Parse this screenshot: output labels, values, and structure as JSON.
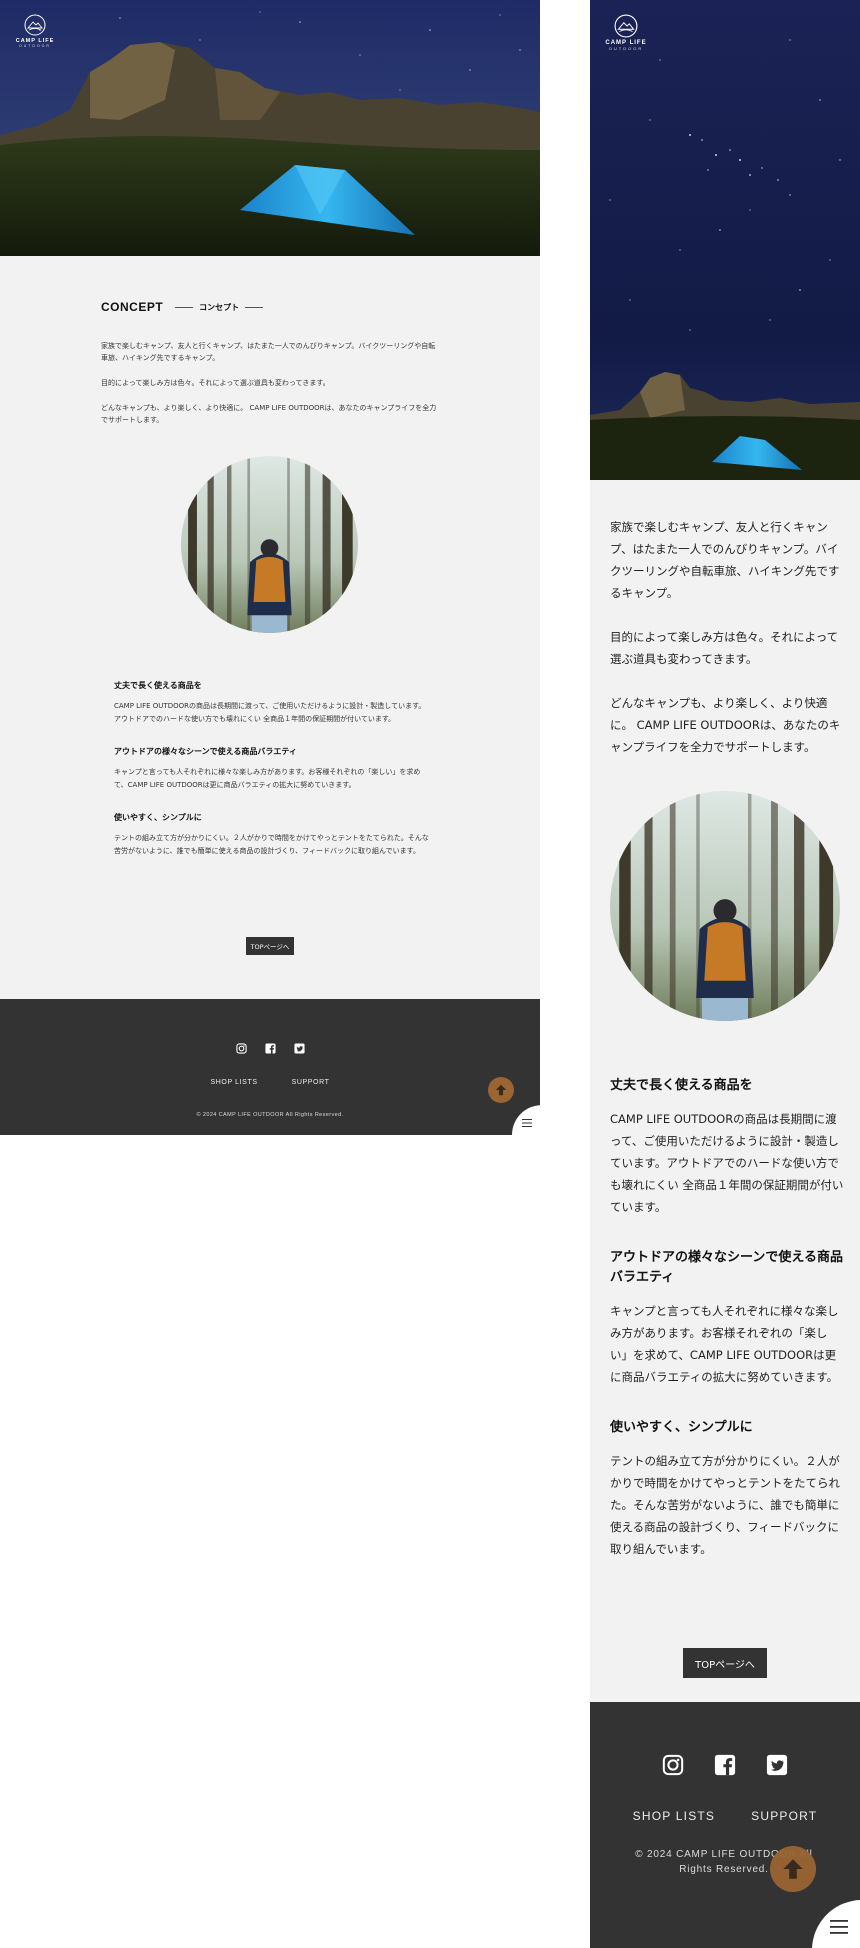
{
  "brand": {
    "name": "CAMP LIFE",
    "sub": "OUTDOOR"
  },
  "concept": {
    "title": "CONCEPT",
    "subtitle": "コンセプト"
  },
  "desktop_paragraphs": [
    "家族で楽しむキャンプ、友人と行くキャンプ、はたまた一人でのんびりキャンプ。バイクツーリングや自転車旅、ハイキング先でするキャンプ。",
    "目的によって楽しみ方は色々。それによって選ぶ道具も変わってきます。",
    "どんなキャンプも、より楽しく、より快適に。 CAMP LIFE OUTDOORは、あなたのキャンプライフを全力でサポートします。"
  ],
  "mobile_paragraphs": [
    "家族で楽しむキャンプ、友人と行くキャンプ、はたまた一人でのんびりキャンプ。バイクツーリングや自転車旅、ハイキング先でするキャンプ。",
    "目的によって楽しみ方は色々。それによって選ぶ道具も変わってきます。",
    "どんなキャンプも、より楽しく、より快適に。 CAMP LIFE OUTDOORは、あなたのキャンプライフを全力でサポートします。"
  ],
  "features": [
    {
      "title": "丈夫で長く使える商品を",
      "body": "CAMP LIFE OUTDOORの商品は長期間に渡って、ご使用いただけるように設計・製造しています。アウトドアでのハードな使い方でも壊れにくい 全商品１年間の保証期間が付いています。"
    },
    {
      "title": "アウトドアの様々なシーンで使える商品バラエティ",
      "body": "キャンプと言っても人それぞれに様々な楽しみ方があります。お客様それぞれの「楽しい」を求めて、CAMP LIFE OUTDOORは更に商品バラエティの拡大に努めていきます。"
    },
    {
      "title": "使いやすく、シンプルに",
      "body": "テントの組み立て方が分かりにくい。２人がかりで時間をかけてやっとテントをたてられた。そんな苦労がないように、誰でも簡単に使える商品の設計づくり、フィードバックに取り組んでいます。"
    }
  ],
  "buttons": {
    "top_page": "TOPページへ"
  },
  "footer": {
    "social": [
      "instagram-icon",
      "facebook-icon",
      "twitter-icon"
    ],
    "links": [
      "SHOP LISTS",
      "SUPPORT"
    ],
    "copyright": "© 2024 CAMP LIFE OUTDOOR All Rights Reserved."
  },
  "colors": {
    "page_bg": "#f2f2f2",
    "footer_bg": "#333333",
    "button_bg": "#333333",
    "scroll_top_accent": "#9a6532",
    "tent": "#29a9e8"
  }
}
